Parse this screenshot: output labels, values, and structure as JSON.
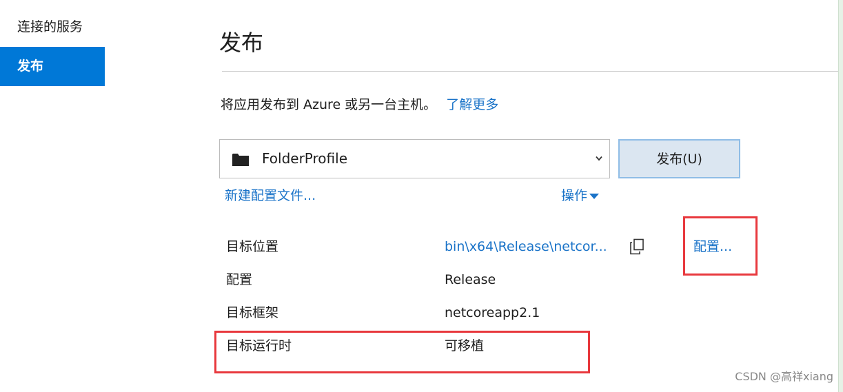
{
  "sidebar": {
    "items": [
      {
        "label": "连接的服务"
      },
      {
        "label": "发布"
      }
    ]
  },
  "main": {
    "title": "发布",
    "description": "将应用发布到 Azure 或另一台主机。",
    "learn_more": "了解更多",
    "profile_select": {
      "value": "FolderProfile"
    },
    "publish_button": "发布(U)",
    "new_profile": "新建配置文件...",
    "actions": "操作",
    "properties": [
      {
        "label": "目标位置",
        "value": "bin\\x64\\Release\\netcor..."
      },
      {
        "label": "配置",
        "value": "Release"
      },
      {
        "label": "目标框架",
        "value": "netcoreapp2.1"
      },
      {
        "label": "目标运行时",
        "value": "可移植"
      }
    ],
    "configure": "配置..."
  },
  "colors": {
    "accent": "#0078d7",
    "link": "#1a73c8",
    "annotation": "#e8383d"
  },
  "icons": {
    "folder": "folder-icon",
    "chevron": "chevron-down-icon",
    "actions_caret": "triangle-down-icon",
    "copy": "copy-icon"
  },
  "watermark": "CSDN @高祥xiang"
}
